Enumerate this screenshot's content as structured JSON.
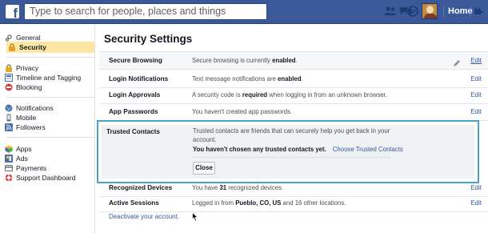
{
  "topbar": {
    "search_placeholder": "Type to search for people, places and things",
    "home_label": "Home",
    "logo_letter": "f"
  },
  "sidebar": {
    "groups": [
      [
        {
          "label": "General",
          "icon": "gear-icon"
        },
        {
          "label": "Security",
          "icon": "lock-icon",
          "active": true
        }
      ],
      [
        {
          "label": "Privacy",
          "icon": "privacy-lock-icon"
        },
        {
          "label": "Timeline and Tagging",
          "icon": "timeline-icon"
        },
        {
          "label": "Blocking",
          "icon": "blocking-icon"
        }
      ],
      [
        {
          "label": "Notifications",
          "icon": "globe-icon"
        },
        {
          "label": "Mobile",
          "icon": "mobile-icon"
        },
        {
          "label": "Followers",
          "icon": "rss-icon"
        }
      ],
      [
        {
          "label": "Apps",
          "icon": "apps-cube-icon"
        },
        {
          "label": "Ads",
          "icon": "ads-icon"
        },
        {
          "label": "Payments",
          "icon": "credit-card-icon"
        },
        {
          "label": "Support Dashboard",
          "icon": "lifebuoy-icon"
        }
      ]
    ]
  },
  "main": {
    "title": "Security Settings",
    "rows": [
      {
        "label": "Secure Browsing",
        "desc_pre": "Secure browsing is currently ",
        "desc_bold": "enabled",
        "desc_post": ".",
        "edit": "Edit"
      },
      {
        "label": "Login Notifications",
        "desc_pre": "Text message notifications are ",
        "desc_bold": "enabled",
        "desc_post": ".",
        "edit": "Edit"
      },
      {
        "label": "Login Approvals",
        "desc_pre": "A security code is ",
        "desc_bold": "required",
        "desc_post": " when logging in from an unknown browser.",
        "edit": "Edit"
      },
      {
        "label": "App Passwords",
        "desc_pre": "You haven't created app passwords.",
        "desc_bold": "",
        "desc_post": "",
        "edit": "Edit"
      }
    ],
    "trusted_contacts": {
      "label": "Trusted Contacts",
      "text": "Trusted contacts are friends that can securely help you get back in your account.",
      "bold_line": "You haven't chosen any trusted contacts yet.",
      "link": "Choose Trusted Contacts",
      "close_button": "Close"
    },
    "rows_after": [
      {
        "label": "Recognized Devices",
        "desc_pre": "You have ",
        "desc_bold": "31",
        "desc_post": " recognized devices.",
        "edit": "Edit"
      },
      {
        "label": "Active Sessions",
        "desc_pre": "Logged in from ",
        "desc_bold": "Pueblo, CO, US",
        "desc_post": " and 16 other locations.",
        "edit": "Edit"
      }
    ],
    "deactivate_link": "Deactivate your account."
  },
  "colors": {
    "brand_blue": "#3b5998",
    "link_blue": "#365899",
    "highlight_border": "#4aa3c8",
    "active_nav": "#fde6a2"
  }
}
